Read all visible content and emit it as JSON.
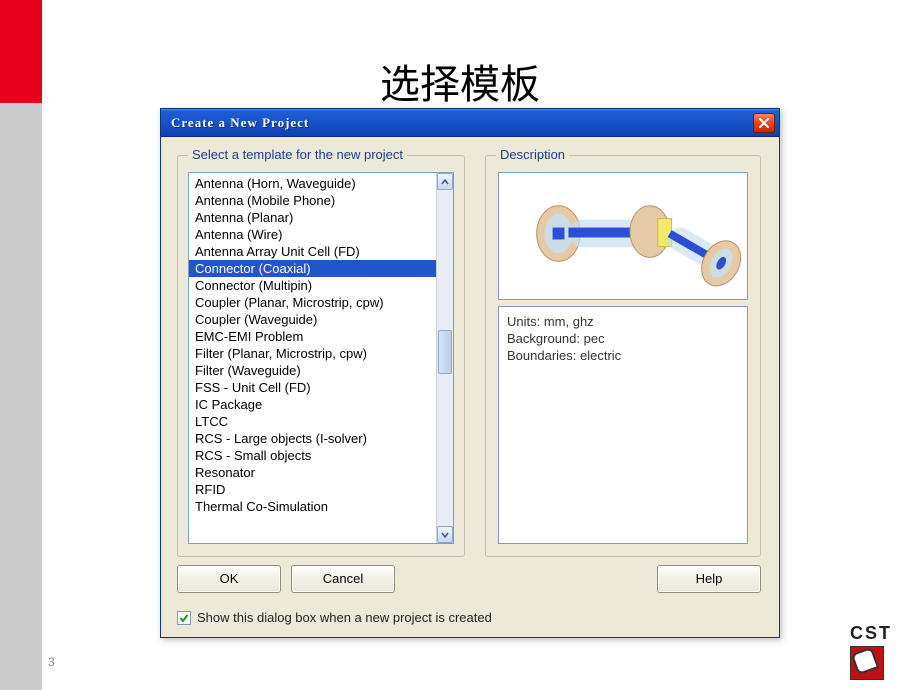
{
  "slide": {
    "title": "选择模板",
    "page_num": "3"
  },
  "dialog": {
    "title": "Create a New Project",
    "group_templates_label": "Select a template for the new project",
    "group_description_label": "Description",
    "templates": [
      "Antenna (Horn, Waveguide)",
      "Antenna (Mobile Phone)",
      "Antenna (Planar)",
      "Antenna (Wire)",
      "Antenna Array Unit Cell (FD)",
      "Connector (Coaxial)",
      "Connector (Multipin)",
      "Coupler (Planar, Microstrip, cpw)",
      "Coupler (Waveguide)",
      "EMC-EMI Problem",
      "Filter (Planar, Microstrip, cpw)",
      "Filter (Waveguide)",
      "FSS - Unit Cell (FD)",
      "IC Package",
      "LTCC",
      "RCS - Large objects (I-solver)",
      "RCS - Small objects",
      "Resonator",
      "RFID",
      "Thermal Co-Simulation"
    ],
    "selected_index": 5,
    "description": {
      "units": "Units: mm, ghz",
      "background": "Background: pec",
      "boundaries": "Boundaries: electric"
    },
    "buttons": {
      "ok": "OK",
      "cancel": "Cancel",
      "help": "Help"
    },
    "checkbox_label": "Show this dialog box when a new project is created",
    "checkbox_checked": true
  },
  "logo": {
    "text": "CST"
  }
}
